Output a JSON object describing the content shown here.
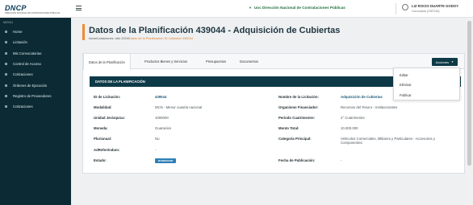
{
  "logo": {
    "name": "DNCP",
    "subtitle": "DIRECCIÓN NACIONAL DE CONTRATACIONES PÚBLICAS"
  },
  "sidebar": {
    "title": "MENU",
    "items": [
      {
        "label": "Home"
      },
      {
        "label": "Licitación"
      },
      {
        "label": "Mis Convocatorias"
      },
      {
        "label": "Control de Acceso"
      },
      {
        "label": "Cotizaciones"
      },
      {
        "label": "Órdenes de Ejecución"
      },
      {
        "label": "Registro de Proveedores"
      },
      {
        "label": "Cotizaciones"
      }
    ]
  },
  "topbar": {
    "org": "Uoc Dirección Nacional de Contrataciones Públicas",
    "user_name": "LIZ ROCIO DUARTE GODOY",
    "user_role": "Convocante (2387164)"
  },
  "header": {
    "title_prefix": "Datos de la Planificación",
    "title_id": "439044 - Adquisición de Cubiertas",
    "breadcrumb_base": "Inicio/Licitaciones: año 2024/",
    "breadcrumb_current": "Datos de la Planificación ID Licitación 439044"
  },
  "tabs": [
    {
      "label": "Datos de la Planificación"
    },
    {
      "label": "Productos Bienes y Servicios"
    },
    {
      "label": "Presupuestos"
    },
    {
      "label": "Documentos"
    }
  ],
  "actions": {
    "label": "Acciones",
    "menu": [
      {
        "label": "Editar"
      },
      {
        "label": "Eliminar"
      },
      {
        "label": "Publicar"
      }
    ]
  },
  "panel": {
    "title": "DATOS DE LA PLANIFICACIÓN",
    "left": [
      {
        "label": "ID de Licitación:",
        "value": "439044"
      },
      {
        "label": "Modalidad:",
        "value": "MCN - Menor cuantía nacional"
      },
      {
        "label": "Unidad Jerárquica:",
        "value": "1000000"
      },
      {
        "label": "Moneda:",
        "value": "Guaraníes"
      },
      {
        "label": "Plurianual:",
        "value": "No"
      },
      {
        "label": "AdReferéndum:",
        "value": "-"
      },
      {
        "label": "Estado:",
        "value": "BORRADOR"
      }
    ],
    "right": [
      {
        "label": "Nombre de la Licitación:",
        "value": "Adquisición de Cubiertas"
      },
      {
        "label": "Organismo Financiador:",
        "value": "Recursos del Tesoro - Institucionales"
      },
      {
        "label": "Periodo Cuatrimestre:",
        "value": "2° Cuatrimestre"
      },
      {
        "label": "Monto Total:",
        "value": "10.000.000"
      },
      {
        "label": "Categoría Principal:",
        "value": "Vehiculos Comerciales, Militares y Particulares - Accesorios y Componentes"
      },
      {
        "label": "Fecha de Publicación:",
        "value": "-"
      }
    ]
  },
  "colors": {
    "primary": "#0e3a47",
    "accent": "#f28a2e",
    "badge": "#2d7fb8",
    "org": "#1f6f3c"
  }
}
